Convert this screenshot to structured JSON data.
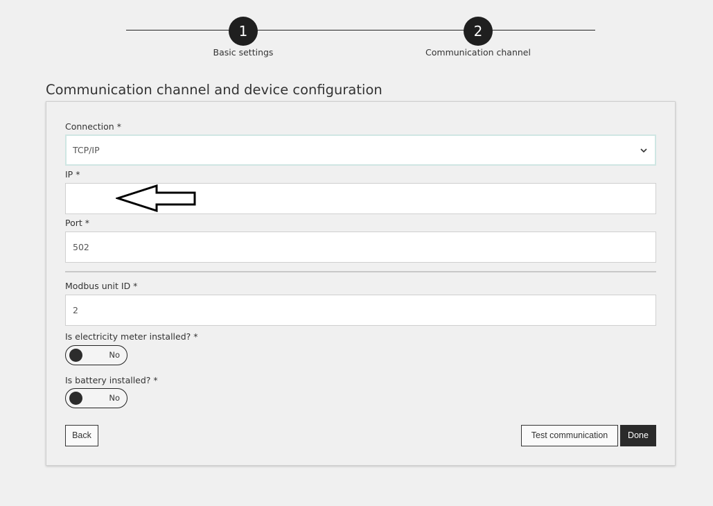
{
  "stepper": {
    "steps": [
      {
        "number": "1",
        "label": "Basic settings"
      },
      {
        "number": "2",
        "label": "Communication channel"
      }
    ]
  },
  "page": {
    "title": "Communication channel and device configuration"
  },
  "form": {
    "connection": {
      "label": "Connection *",
      "value": "TCP/IP"
    },
    "ip": {
      "label": "IP *",
      "value": ""
    },
    "port": {
      "label": "Port *",
      "value": "502"
    },
    "modbus": {
      "label": "Modbus unit ID *",
      "value": "2"
    },
    "meter": {
      "label": "Is electricity meter installed? *",
      "value": "No"
    },
    "battery": {
      "label": "Is battery installed? *",
      "value": "No"
    }
  },
  "buttons": {
    "back": "Back",
    "test": "Test communication",
    "done": "Done"
  },
  "icons": {
    "chevron": "chevron-down-icon",
    "arrow": "arrow-left-annotation-icon"
  }
}
